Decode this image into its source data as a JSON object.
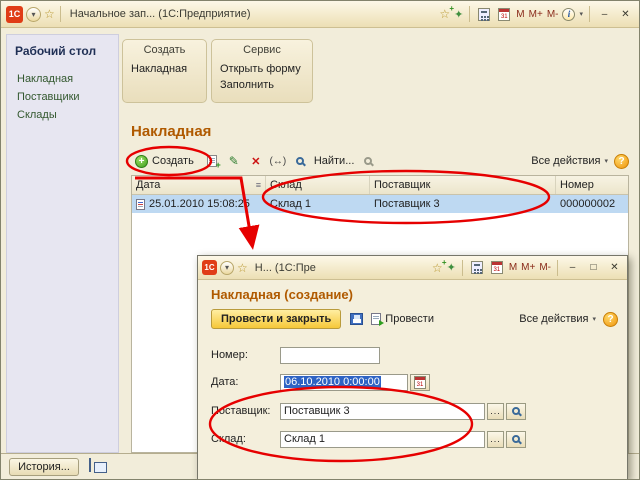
{
  "app_title": "Начальное зап...  (1С:Предприятие)",
  "logo_text": "1С",
  "titlebar": {
    "m": "M",
    "m_plus": "M+",
    "m_minus": "M-",
    "minimize": "–",
    "maximize": "□",
    "close": "✕",
    "calendar_day": "31"
  },
  "sidebar": {
    "title": "Рабочий стол",
    "items": [
      {
        "label": "Накладная"
      },
      {
        "label": "Поставщики"
      },
      {
        "label": "Склады"
      }
    ]
  },
  "command_panel": {
    "groups": [
      {
        "title": "Создать",
        "buttons": [
          {
            "label": "Накладная"
          }
        ]
      },
      {
        "title": "Сервис",
        "buttons": [
          {
            "label": "Открыть форму"
          },
          {
            "label": "Заполнить"
          }
        ]
      }
    ]
  },
  "list": {
    "heading": "Накладная",
    "toolbar": {
      "create": "Создать",
      "find": "Найти...",
      "all_actions": "Все действия",
      "help": "?"
    },
    "columns": [
      {
        "label": "Дата"
      },
      {
        "label": "Склад"
      },
      {
        "label": "Поставщик"
      },
      {
        "label": "Номер"
      }
    ],
    "row": {
      "date": "25.01.2010 15:08:25",
      "warehouse": "Склад 1",
      "supplier": "Поставщик 3",
      "number": "000000002"
    }
  },
  "dialog": {
    "title": "Н...  (1С:Пре",
    "heading": "Накладная (создание)",
    "post_and_close": "Провести и закрыть",
    "post": "Провести",
    "all_actions": "Все действия",
    "help": "?",
    "fields": {
      "number_label": "Номер:",
      "number_value": "",
      "date_label": "Дата:",
      "date_value": "06.10.2010  0:00:00",
      "supplier_label": "Поставщик:",
      "supplier_value": "Поставщик 3",
      "warehouse_label": "Склад:",
      "warehouse_value": "Склад 1",
      "choose": "..."
    }
  },
  "footer": {
    "history": "История..."
  }
}
